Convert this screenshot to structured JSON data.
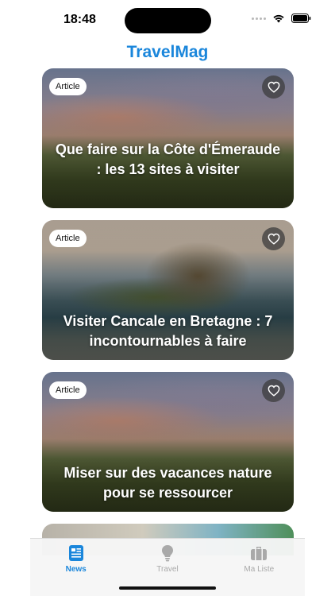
{
  "status": {
    "time": "18:48"
  },
  "app": {
    "title": "TravelMag"
  },
  "cards": [
    {
      "badge": "Article",
      "title": "Que faire sur la Côte d'Émeraude : les 13 sites à visiter"
    },
    {
      "badge": "Article",
      "title": "Visiter Cancale en Bretagne : 7 incontournables à faire"
    },
    {
      "badge": "Article",
      "title": "Miser sur des vacances nature pour se ressourcer"
    }
  ],
  "tabs": [
    {
      "label": "News",
      "icon": "newspaper-icon",
      "active": true
    },
    {
      "label": "Travel",
      "icon": "lightbulb-icon",
      "active": false
    },
    {
      "label": "Ma Liste",
      "icon": "suitcase-icon",
      "active": false
    }
  ],
  "colors": {
    "accent": "#1a86db",
    "inactive": "#a9a9a9"
  }
}
